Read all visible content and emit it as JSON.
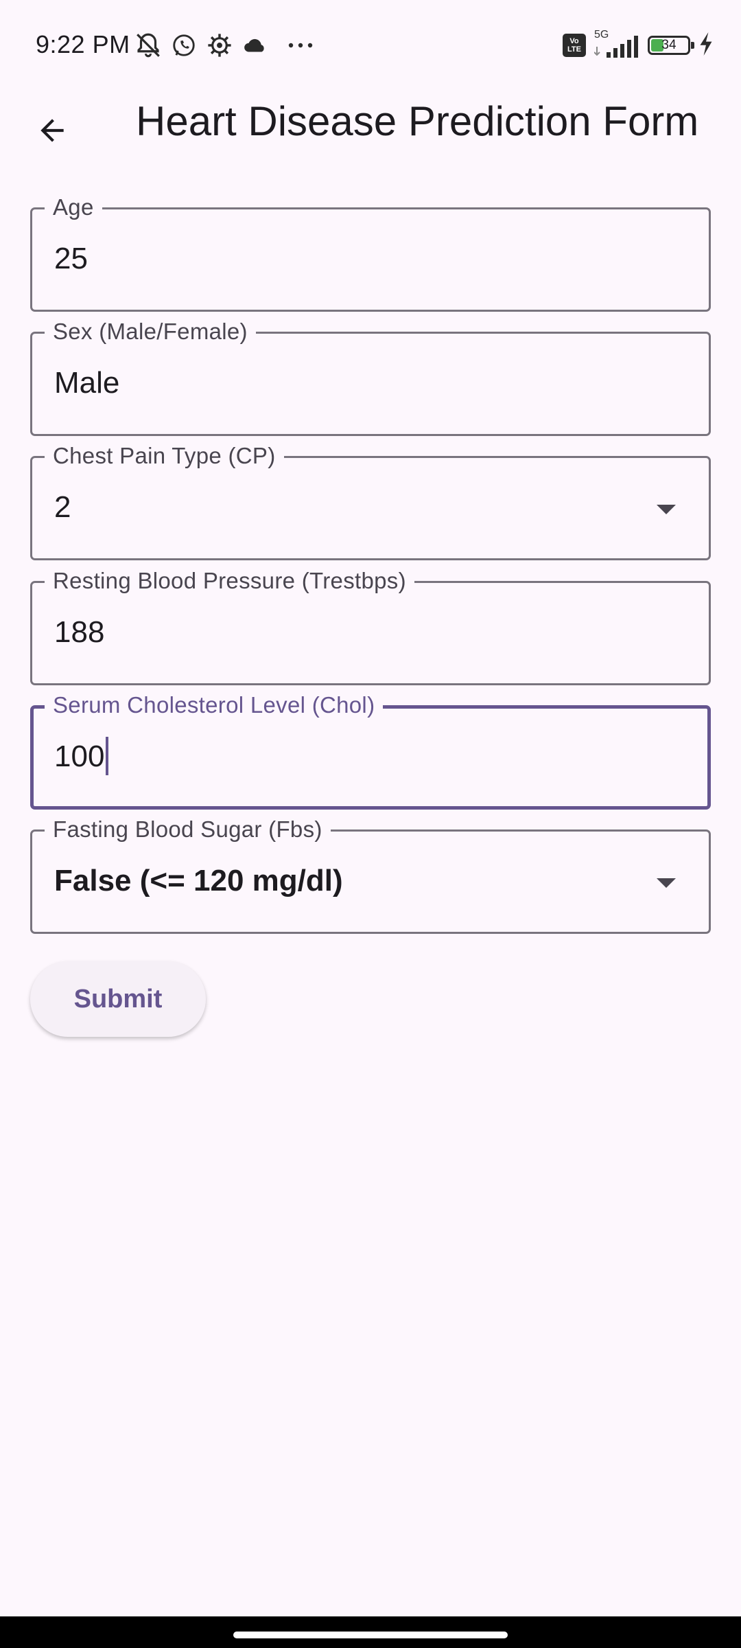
{
  "status_bar": {
    "time": "9:22 PM",
    "icons_left": [
      "muted-bell-icon",
      "whatsapp-icon",
      "gear-icon",
      "cloud-icon",
      "more-dots-icon"
    ],
    "volte_label_top": "Vo",
    "volte_label_bottom": "LTE",
    "network_label": "5G",
    "battery_percent": "34",
    "battery_level": 0.34,
    "charging": true
  },
  "app_bar": {
    "back_icon": "arrow-back-icon",
    "title": "Heart Disease Prediction Form"
  },
  "form": {
    "fields": [
      {
        "label": "Age",
        "value": "25",
        "type": "text"
      },
      {
        "label": "Sex (Male/Female)",
        "value": "Male",
        "type": "text"
      },
      {
        "label": "Chest Pain Type (CP)",
        "value": "2",
        "type": "dropdown"
      },
      {
        "label": "Resting Blood Pressure (Trestbps)",
        "value": "188",
        "type": "text"
      },
      {
        "label": "Serum Cholesterol Level (Chol)",
        "value": "100",
        "type": "text",
        "focused": true
      },
      {
        "label": "Fasting Blood Sugar (Fbs)",
        "value": "False (<= 120 mg/dl)",
        "type": "dropdown"
      }
    ],
    "submit_label": "Submit"
  },
  "colors": {
    "background": "#fdf7fd",
    "primary": "#65558f",
    "outline": "#79747e",
    "on_surface": "#1d1b20",
    "label": "#49454f"
  }
}
